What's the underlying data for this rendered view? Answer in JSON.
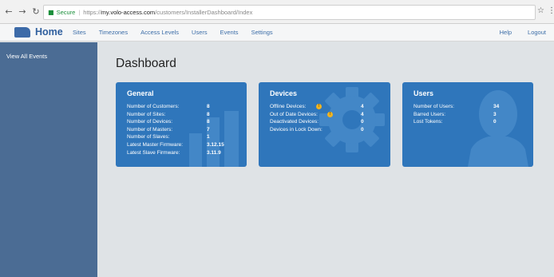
{
  "browser": {
    "back_icon": "back-arrow-icon",
    "forward_icon": "forward-arrow-icon",
    "reload_icon": "reload-icon",
    "secure_label": "Secure",
    "url_scheme": "https://",
    "url_host": "my.volo-access.com",
    "url_path": "/customers/InstallerDashboard/Index"
  },
  "nav": {
    "home": "Home",
    "items": [
      "Sites",
      "Timezones",
      "Access Levels",
      "Users",
      "Events",
      "Settings"
    ],
    "right": [
      "Help",
      "Logout"
    ]
  },
  "sidebar": {
    "items": [
      "View All Events"
    ]
  },
  "page": {
    "title": "Dashboard"
  },
  "cards": {
    "general": {
      "title": "General",
      "rows": [
        {
          "label": "Number of Customers:",
          "value": "8"
        },
        {
          "label": "Number of Sites:",
          "value": "8"
        },
        {
          "label": "Number of Devices:",
          "value": "8"
        },
        {
          "label": "Number of Masters:",
          "value": "7"
        },
        {
          "label": "Number of Slaves:",
          "value": "1"
        },
        {
          "label": "Latest Master Firmware:",
          "value": "3.12.15"
        },
        {
          "label": "Latest Slave Firmware:",
          "value": "3.11.9"
        }
      ]
    },
    "devices": {
      "title": "Devices",
      "rows": [
        {
          "label": "Offline Devices:",
          "value": "4",
          "warn": true
        },
        {
          "label": "Out of Date Devices:",
          "value": "4",
          "warn": true
        },
        {
          "label": "Deactivated Devices:",
          "value": "0"
        },
        {
          "label": "Devices in Lock Down:",
          "value": "0"
        }
      ]
    },
    "users": {
      "title": "Users",
      "rows": [
        {
          "label": "Number of Users:",
          "value": "34"
        },
        {
          "label": "Barred Users:",
          "value": "3"
        },
        {
          "label": "Lost Tokens:",
          "value": "0"
        }
      ]
    }
  },
  "colors": {
    "card_blue": "#2f76bb",
    "sidebar_blue": "#4b6c94",
    "warning": "#f0b321"
  }
}
